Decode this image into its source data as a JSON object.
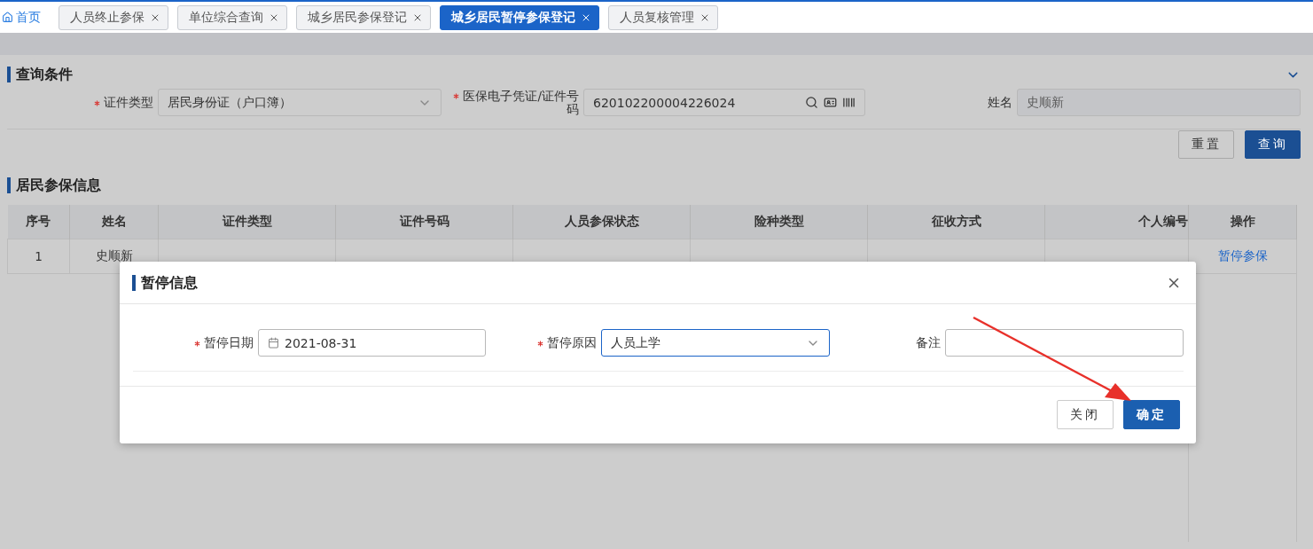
{
  "tabs": [
    {
      "label": "首页",
      "kind": "home",
      "selected": false
    },
    {
      "label": "人员终止参保",
      "kind": "closable",
      "selected": false
    },
    {
      "label": "单位综合查询",
      "kind": "closable",
      "selected": false
    },
    {
      "label": "城乡居民参保登记",
      "kind": "closable",
      "selected": false
    },
    {
      "label": "城乡居民暂停参保登记",
      "kind": "closable",
      "selected": true
    },
    {
      "label": "人员复核管理",
      "kind": "closable",
      "selected": false
    }
  ],
  "query": {
    "title": "查询条件",
    "fields": [
      {
        "label": "证件类型",
        "required": true,
        "kind": "select",
        "value": "居民身份证（户口簿）",
        "disabled": false
      },
      {
        "label": "医保电子凭证/证件号码",
        "required": true,
        "kind": "id_input",
        "value": "620102200004226024",
        "disabled": false
      },
      {
        "label": "姓名",
        "required": false,
        "kind": "text",
        "value": "史顺新",
        "disabled": true
      }
    ],
    "buttons": [
      {
        "label": "重置",
        "primary": false
      },
      {
        "label": "查询",
        "primary": true
      }
    ]
  },
  "table": {
    "title": "居民参保信息",
    "columns": [
      "序号",
      "姓名",
      "证件类型",
      "证件号码",
      "人员参保状态",
      "险种类型",
      "征收方式",
      "个人编号",
      "操作"
    ],
    "rows": [
      {
        "cells": [
          "1",
          "史顺新"
        ],
        "action": "暂停参保"
      }
    ]
  },
  "dialog": {
    "title": "暂停信息",
    "fields": [
      {
        "label": "暂停日期",
        "required": true,
        "kind": "date",
        "value": "2021-08-31",
        "focused": false
      },
      {
        "label": "暂停原因",
        "required": true,
        "kind": "select",
        "value": "人员上学",
        "focused": true
      },
      {
        "label": "备注",
        "required": false,
        "kind": "text",
        "focused": false
      }
    ],
    "buttons": [
      {
        "label": "关闭",
        "primary": false
      },
      {
        "label": "确定",
        "primary": true
      }
    ]
  }
}
